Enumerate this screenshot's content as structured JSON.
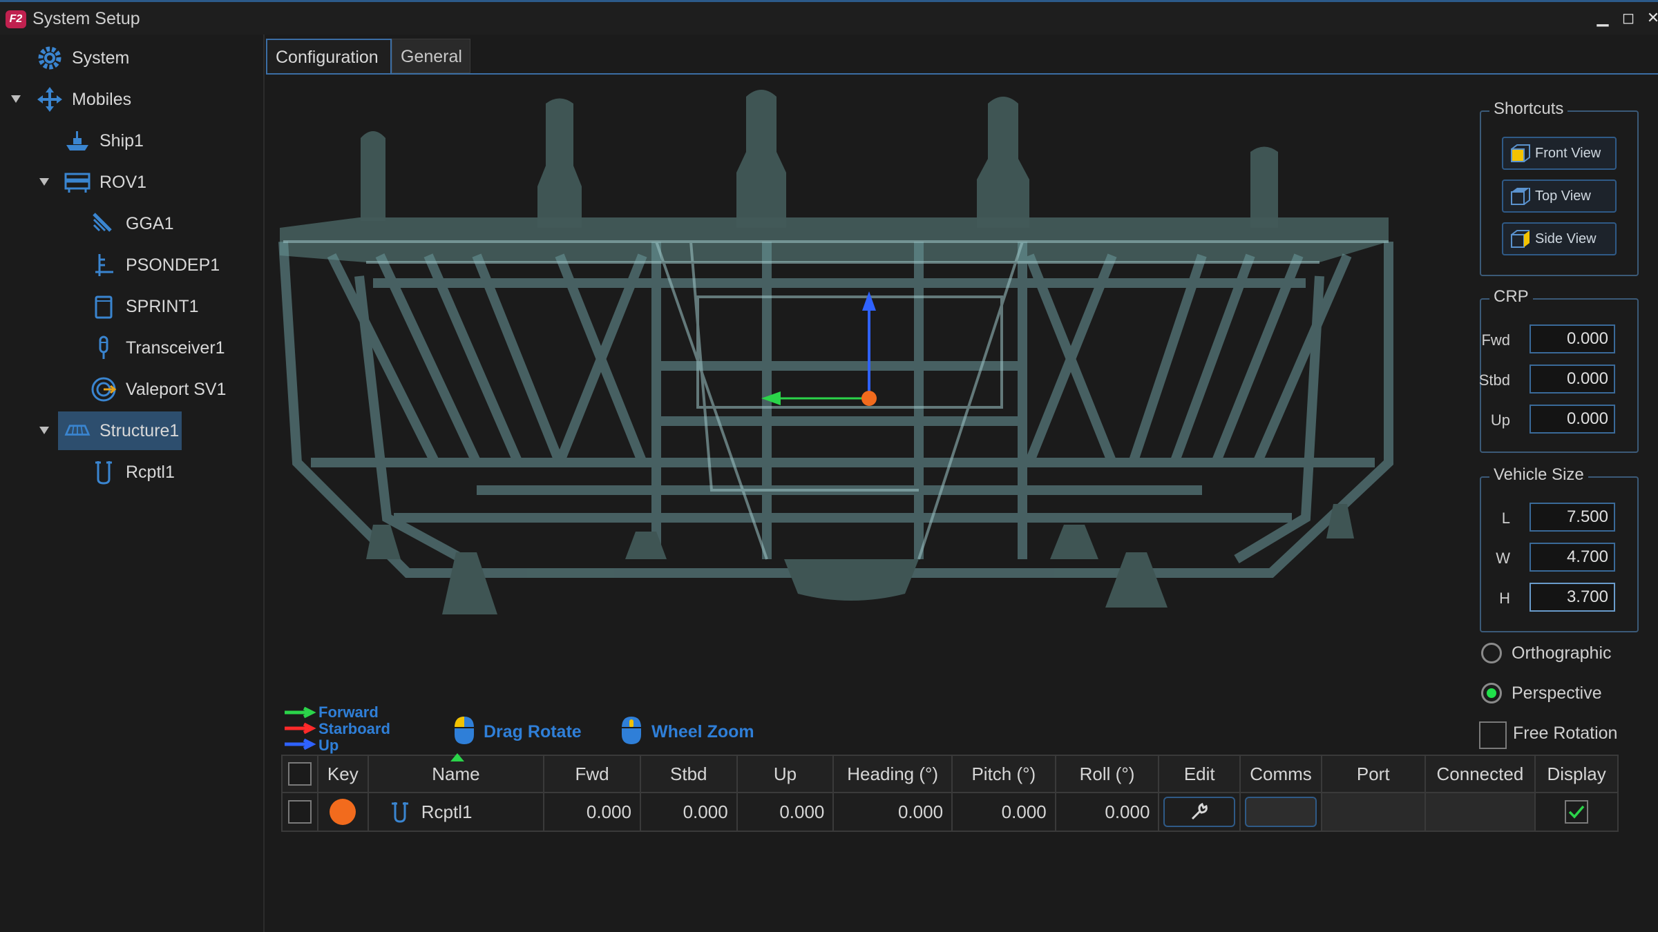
{
  "window": {
    "title": "System Setup",
    "logo": "F2"
  },
  "sidebar": {
    "items": [
      {
        "label": "System",
        "icon": "gear-icon"
      },
      {
        "label": "Mobiles",
        "icon": "move-arrows-icon"
      },
      {
        "label": "Ship1",
        "icon": "ship-icon"
      },
      {
        "label": "ROV1",
        "icon": "rov-icon"
      },
      {
        "label": "GGA1",
        "icon": "gps-antenna-icon"
      },
      {
        "label": "PSONDEP1",
        "icon": "depth-sensor-icon"
      },
      {
        "label": "SPRINT1",
        "icon": "ins-sensor-icon"
      },
      {
        "label": "Transceiver1",
        "icon": "transceiver-icon"
      },
      {
        "label": "Valeport SV1",
        "icon": "sound-velocity-icon"
      },
      {
        "label": "Structure1",
        "icon": "structure-icon"
      },
      {
        "label": "Rcptl1",
        "icon": "receptacle-icon"
      }
    ]
  },
  "tabs": [
    {
      "label": "Configuration"
    },
    {
      "label": "General"
    }
  ],
  "shortcuts": {
    "title": "Shortcuts",
    "buttons": [
      {
        "label": "Front View"
      },
      {
        "label": "Top View"
      },
      {
        "label": "Side View"
      }
    ]
  },
  "crp": {
    "title": "CRP",
    "fields": [
      {
        "label": "Fwd",
        "value": "0.000"
      },
      {
        "label": "Stbd",
        "value": "0.000"
      },
      {
        "label": "Up",
        "value": "0.000"
      }
    ]
  },
  "vehicle_size": {
    "title": "Vehicle Size",
    "fields": [
      {
        "label": "L",
        "value": "7.500"
      },
      {
        "label": "W",
        "value": "4.700"
      },
      {
        "label": "H",
        "value": "3.700"
      }
    ]
  },
  "view_options": {
    "orthographic": "Orthographic",
    "perspective": "Perspective",
    "free_rotation": "Free Rotation",
    "selected": "Perspective"
  },
  "axis_legend": {
    "forward": "Forward",
    "starboard": "Starboard",
    "up": "Up"
  },
  "hints": {
    "drag_rotate": "Drag Rotate",
    "wheel_zoom": "Wheel Zoom"
  },
  "table": {
    "columns": [
      "",
      "Key",
      "Name",
      "Fwd",
      "Stbd",
      "Up",
      "Heading (°)",
      "Pitch (°)",
      "Roll (°)",
      "Edit",
      "Comms",
      "Port",
      "Connected",
      "Display"
    ],
    "rows": [
      {
        "key_color": "#f26b1d",
        "name": "Rcptl1",
        "fwd": "0.000",
        "stbd": "0.000",
        "up": "0.000",
        "heading": "0.000",
        "pitch": "0.000",
        "roll": "0.000",
        "display": true
      }
    ]
  },
  "colors": {
    "accent": "#3b6ea5",
    "selection": "#2d4e6e",
    "hint_blue": "#2f7fd8",
    "key_orange": "#f26b1d",
    "structure": "#4a6a6e"
  }
}
